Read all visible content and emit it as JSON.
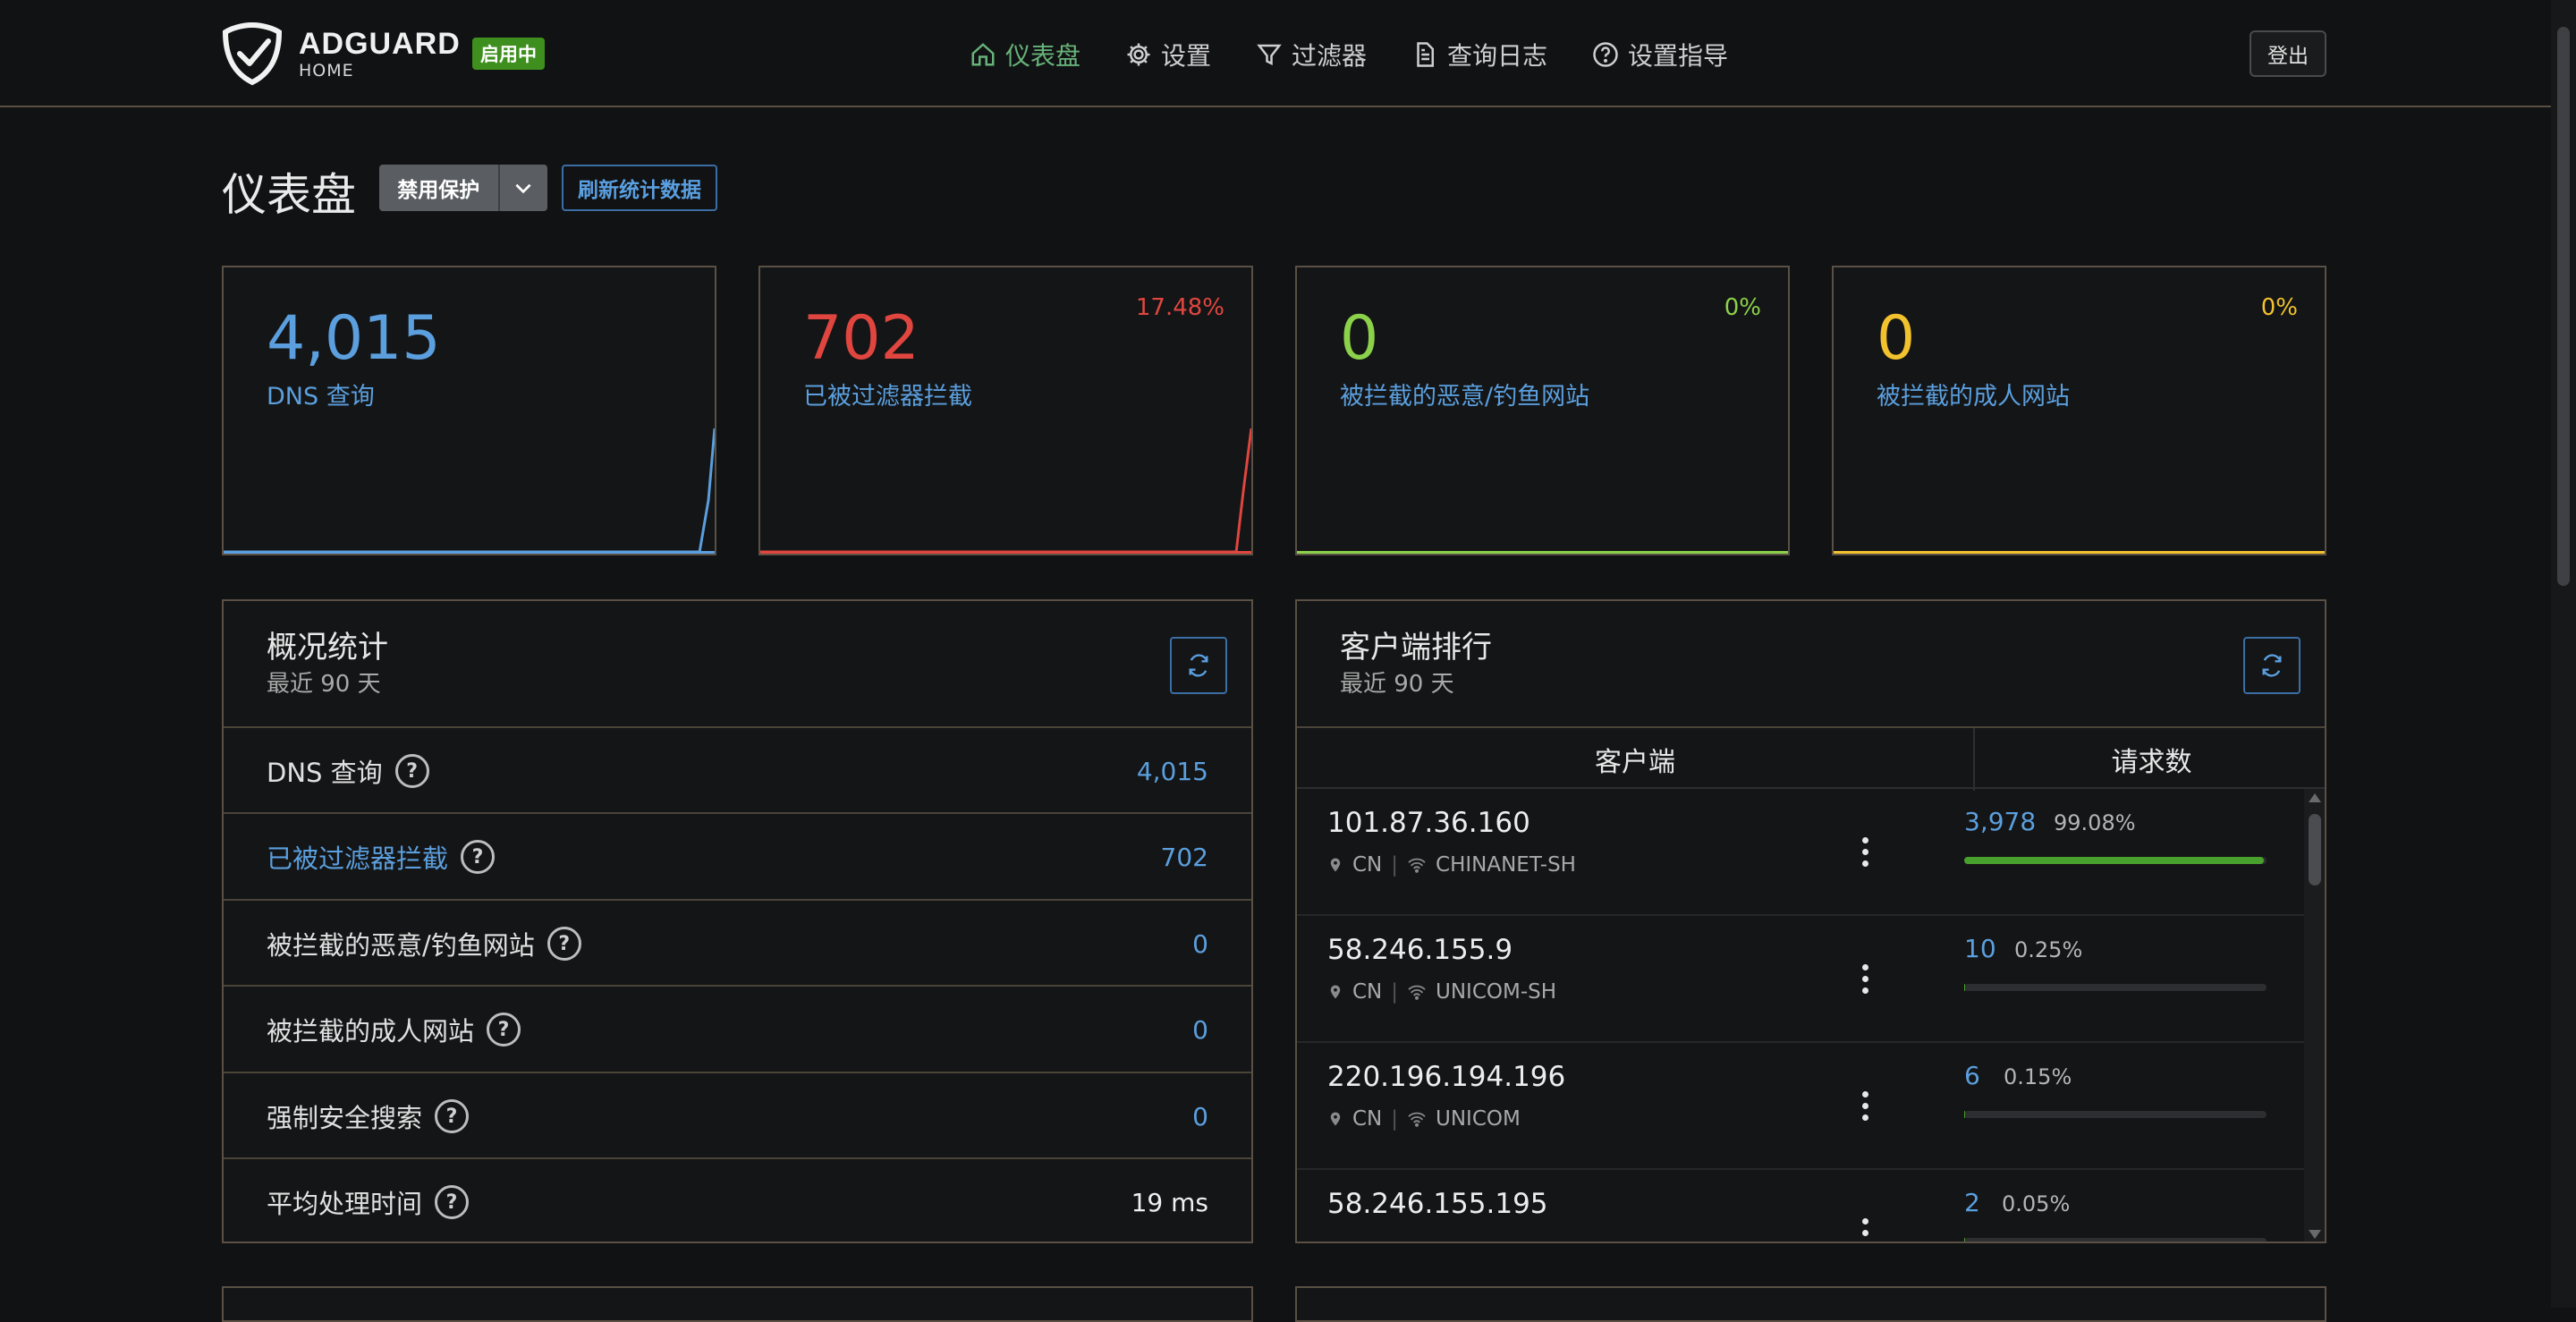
{
  "header": {
    "brand": "ADGUARD",
    "brand_sub": "HOME",
    "status_badge": "启用中",
    "nav": [
      {
        "label": "仪表盘",
        "icon": "home-icon",
        "active": true
      },
      {
        "label": "设置",
        "icon": "gear-icon"
      },
      {
        "label": "过滤器",
        "icon": "filter-icon"
      },
      {
        "label": "查询日志",
        "icon": "document-icon"
      },
      {
        "label": "设置指导",
        "icon": "help-circle-icon"
      }
    ],
    "logout": "登出"
  },
  "title_row": {
    "title": "仪表盘",
    "disable_protection": "禁用保护",
    "refresh_stats": "刷新统计数据"
  },
  "cards": [
    {
      "value": "4,015",
      "label": "DNS 查询",
      "percent": "",
      "color": "#5b9fde"
    },
    {
      "value": "702",
      "label": "已被过滤器拦截",
      "percent": "17.48%",
      "color": "#e0463f"
    },
    {
      "value": "0",
      "label": "被拦截的恶意/钓鱼网站",
      "percent": "0%",
      "color": "#8bd14a"
    },
    {
      "value": "0",
      "label": "被拦截的成人网站",
      "percent": "0%",
      "color": "#f2c12e"
    }
  ],
  "overview": {
    "title": "概况统计",
    "subtitle": "最近 90 天",
    "rows": [
      {
        "label": "DNS 查询",
        "value": "4,015"
      },
      {
        "label": "已被过滤器拦截",
        "value": "702"
      },
      {
        "label": "被拦截的恶意/钓鱼网站",
        "value": "0"
      },
      {
        "label": "被拦截的成人网站",
        "value": "0"
      },
      {
        "label": "强制安全搜索",
        "value": "0"
      },
      {
        "label": "平均处理时间",
        "value": "19 ms"
      }
    ]
  },
  "clients": {
    "title": "客户端排行",
    "subtitle": "最近 90 天",
    "col_client": "客户端",
    "col_requests": "请求数",
    "rows": [
      {
        "ip": "101.87.36.160",
        "country": "CN",
        "network": "CHINANET-SH",
        "count": "3,978",
        "percent": "99.08%",
        "fraction": 0.9908
      },
      {
        "ip": "58.246.155.9",
        "country": "CN",
        "network": "UNICOM-SH",
        "count": "10",
        "percent": "0.25%",
        "fraction": 0.0025
      },
      {
        "ip": "220.196.194.196",
        "country": "CN",
        "network": "UNICOM",
        "count": "6",
        "percent": "0.15%",
        "fraction": 0.0015
      },
      {
        "ip": "58.246.155.195",
        "country": "",
        "network": "",
        "count": "2",
        "percent": "0.05%",
        "fraction": 0.0005
      }
    ]
  }
}
